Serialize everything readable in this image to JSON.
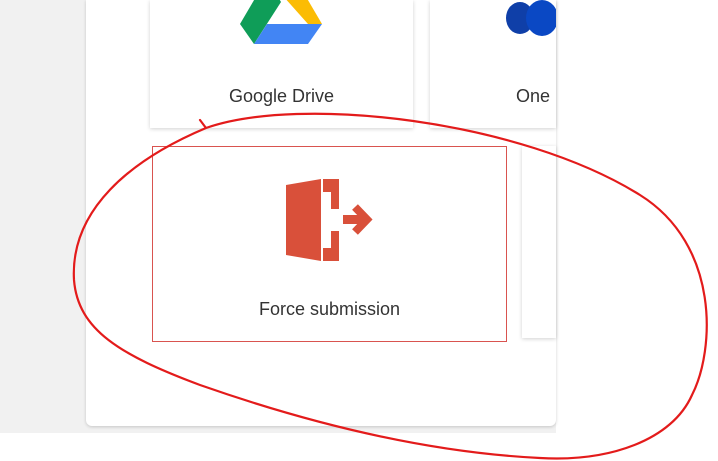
{
  "tiles": [
    {
      "label": "Google Drive",
      "icon": "google-drive-icon"
    },
    {
      "label": "One",
      "icon": "onedrive-icon"
    },
    {
      "label": "Force submission",
      "icon": "exit-door-icon",
      "selected": true
    }
  ],
  "colors": {
    "selected_border": "#d9534f",
    "force_icon": "#d9503a",
    "annotation_stroke": "#e31b1b",
    "page_background": "#f1f1f1"
  }
}
